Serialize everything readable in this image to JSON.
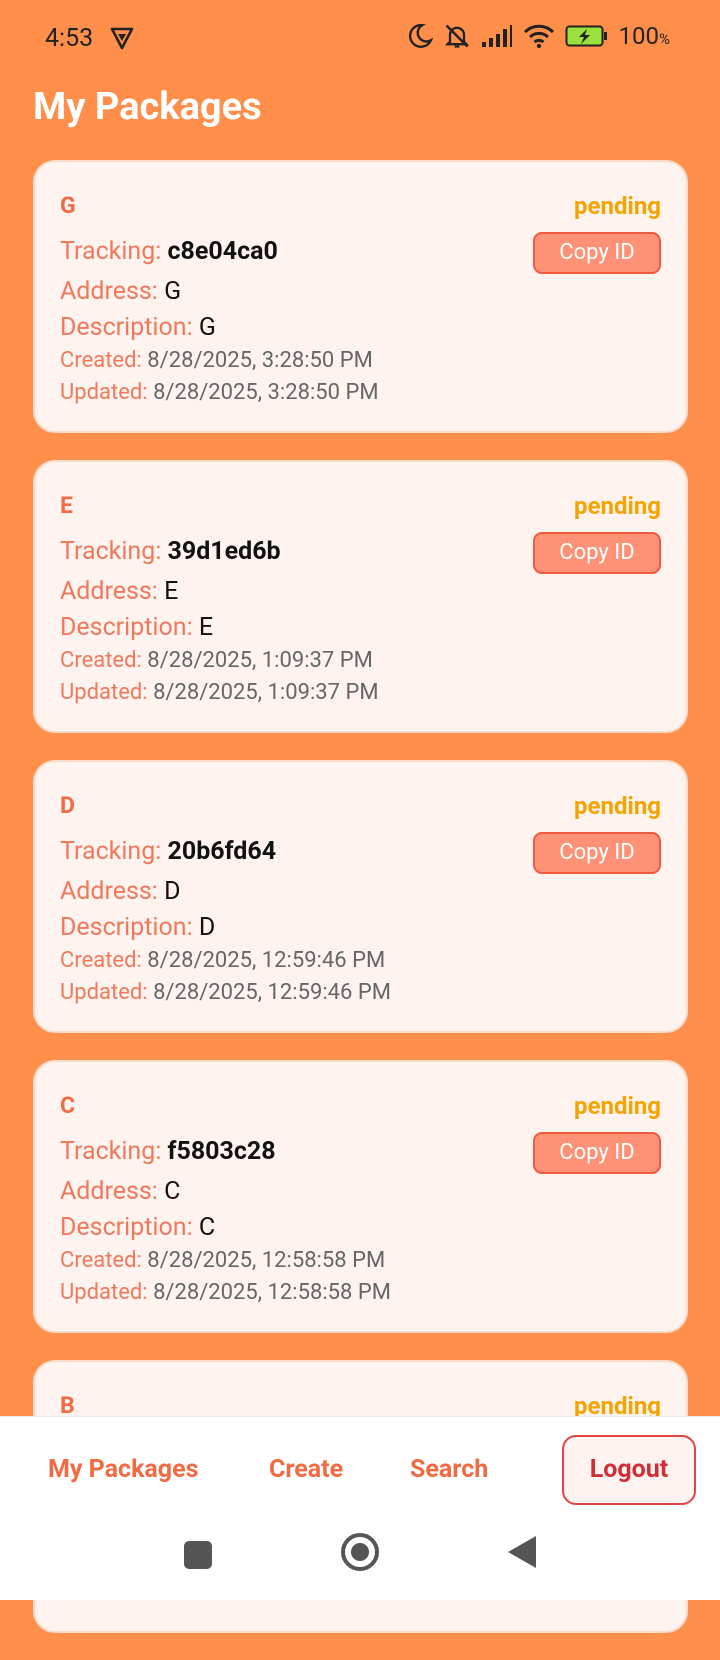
{
  "status_bar": {
    "time": "4:53",
    "battery": "100",
    "battery_unit": "%"
  },
  "page": {
    "title": "My Packages"
  },
  "packages": [
    {
      "name": "G",
      "status": "pending",
      "tracking_label": "Tracking:",
      "tracking": "c8e04ca0",
      "address_label": "Address:",
      "address": "G",
      "description_label": "Description:",
      "description": "G",
      "created_label": "Created:",
      "created": "8/28/2025, 3:28:50 PM",
      "updated_label": "Updated:",
      "updated": "8/28/2025, 3:28:50 PM",
      "copy_label": "Copy ID"
    },
    {
      "name": "E",
      "status": "pending",
      "tracking_label": "Tracking:",
      "tracking": "39d1ed6b",
      "address_label": "Address:",
      "address": "E",
      "description_label": "Description:",
      "description": "E",
      "created_label": "Created:",
      "created": "8/28/2025, 1:09:37 PM",
      "updated_label": "Updated:",
      "updated": "8/28/2025, 1:09:37 PM",
      "copy_label": "Copy ID"
    },
    {
      "name": "D",
      "status": "pending",
      "tracking_label": "Tracking:",
      "tracking": "20b6fd64",
      "address_label": "Address:",
      "address": "D",
      "description_label": "Description:",
      "description": "D",
      "created_label": "Created:",
      "created": "8/28/2025, 12:59:46 PM",
      "updated_label": "Updated:",
      "updated": "8/28/2025, 12:59:46 PM",
      "copy_label": "Copy ID"
    },
    {
      "name": "C",
      "status": "pending",
      "tracking_label": "Tracking:",
      "tracking": "f5803c28",
      "address_label": "Address:",
      "address": "C",
      "description_label": "Description:",
      "description": "C",
      "created_label": "Created:",
      "created": "8/28/2025, 12:58:58 PM",
      "updated_label": "Updated:",
      "updated": "8/28/2025, 12:58:58 PM",
      "copy_label": "Copy ID"
    },
    {
      "name": "B",
      "status": "pending"
    }
  ],
  "bottom_nav": {
    "my_packages": "My Packages",
    "create": "Create",
    "search": "Search",
    "logout": "Logout"
  },
  "colors": {
    "background": "#ff8f4a",
    "accent": "#f06a42",
    "status_pending": "#f5a300",
    "logout": "#d02e35"
  },
  "icons": [
    "vpn-shield-icon",
    "moon-icon",
    "bell-off-icon",
    "signal-icon",
    "wifi-icon",
    "battery-charging-icon",
    "home-square-icon",
    "recents-circle-icon",
    "back-triangle-icon"
  ]
}
